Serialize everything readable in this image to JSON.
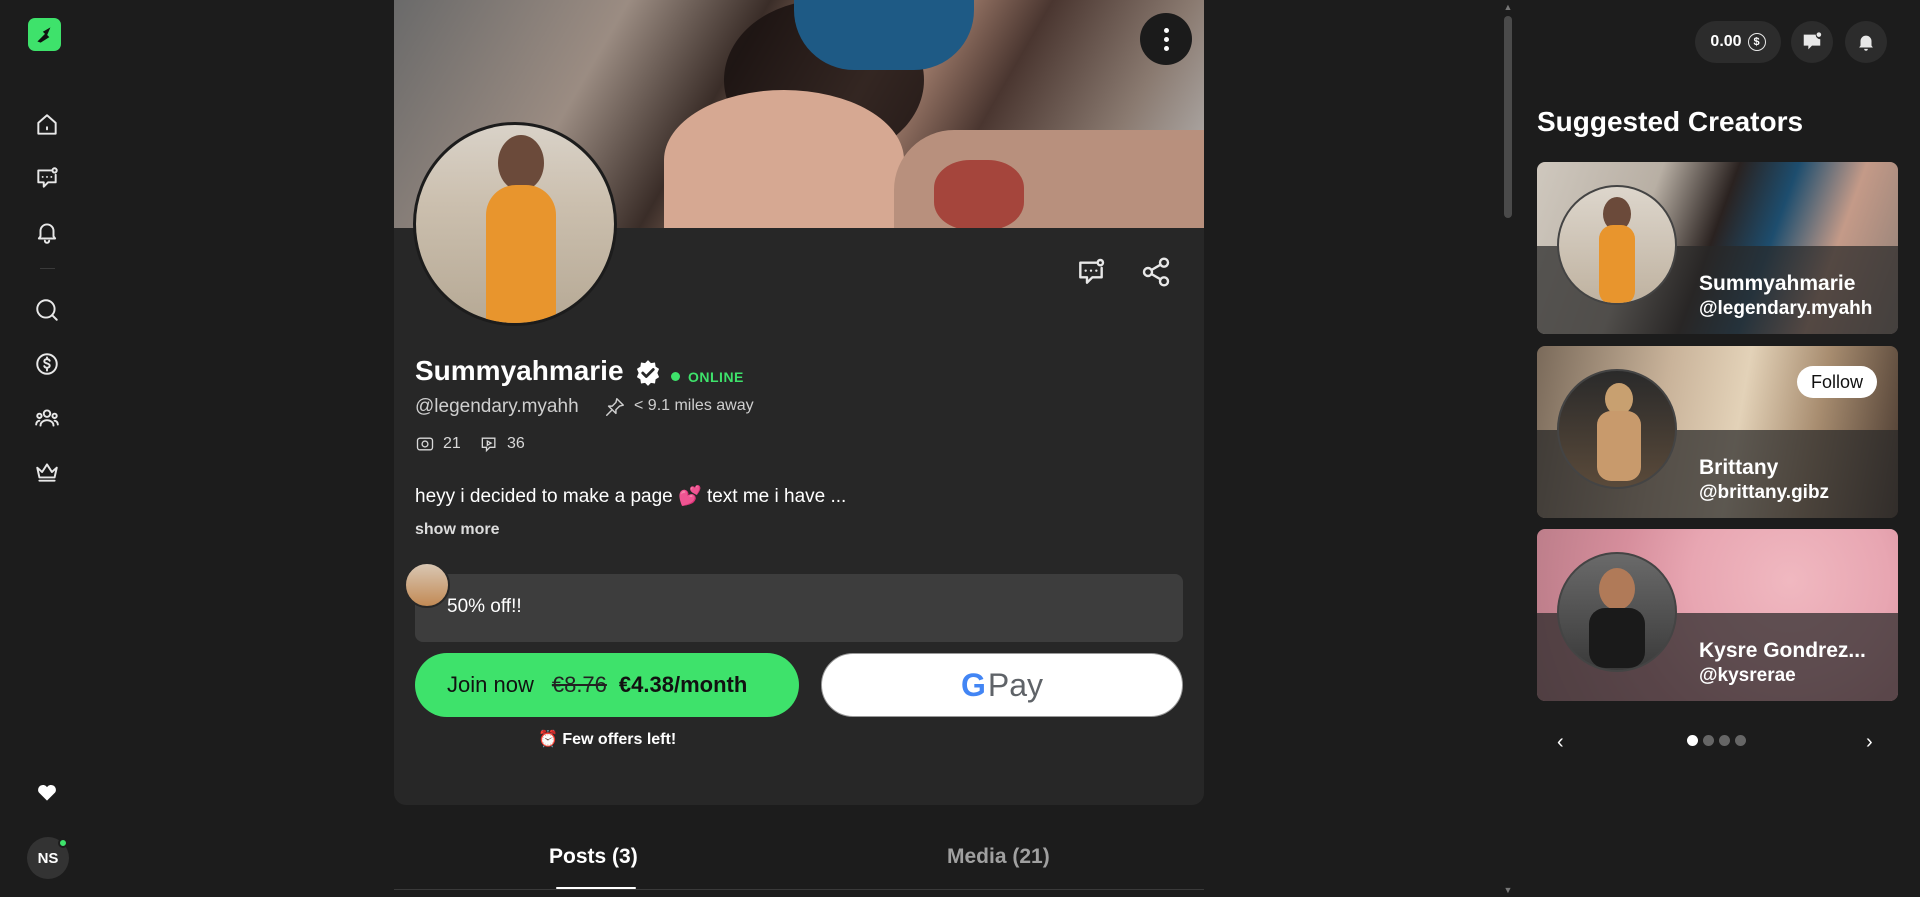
{
  "nav": {
    "items": [
      "home-icon",
      "messages-icon",
      "bell-icon",
      "search-icon",
      "dollar-icon",
      "users-icon",
      "crown-icon"
    ],
    "user_initials": "NS"
  },
  "profile": {
    "name": "Summyahmarie",
    "status": "ONLINE",
    "handle": "@legendary.myahh",
    "distance": "< 9.1 miles away",
    "photos_count": "21",
    "videos_count": "36",
    "bio": "heyy i decided to make a page 💕 text me i have ...",
    "show_more": "show more",
    "promo": "50% off!!",
    "join_label": "Join now",
    "old_price": "€8.76",
    "new_price": "€4.38/month",
    "gpay_g": "G",
    "gpay_label": "Pay",
    "few_offers": "⏰ Few offers left!"
  },
  "tabs": {
    "posts": "Posts (3)",
    "media": "Media (21)"
  },
  "header": {
    "balance": "0.00",
    "coin_symbol": "$"
  },
  "suggested": {
    "title": "Suggested Creators",
    "follow_label": "Follow",
    "cards": [
      {
        "name": "Summyahmarie",
        "handle": "@legendary.myahh"
      },
      {
        "name": "Brittany",
        "handle": "@brittany.gibz"
      },
      {
        "name": "Kysre Gondrez...",
        "handle": "@kysrerae"
      }
    ],
    "prev": "‹",
    "next": "›"
  },
  "colors": {
    "accent": "#3ee26b",
    "background": "#1c1c1c",
    "card": "#272727"
  }
}
